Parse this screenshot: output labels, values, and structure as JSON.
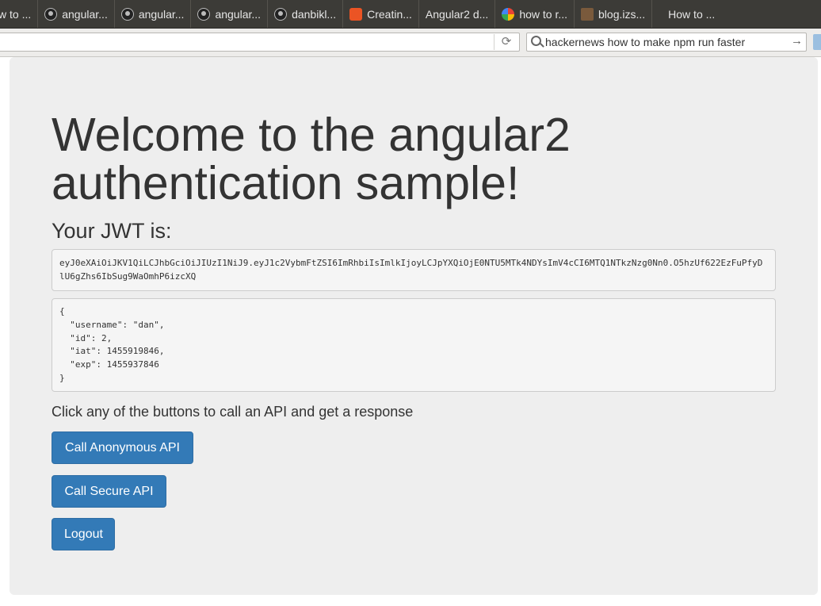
{
  "bookmarks": [
    {
      "label": "w to ...",
      "icon": "none"
    },
    {
      "label": "angular...",
      "icon": "github-icon"
    },
    {
      "label": "angular...",
      "icon": "github-icon"
    },
    {
      "label": "angular...",
      "icon": "github-icon"
    },
    {
      "label": "danbikl...",
      "icon": "github-icon"
    },
    {
      "label": "Creatin...",
      "icon": "auth0-icon"
    },
    {
      "label": "Angular2 d...",
      "icon": "none"
    },
    {
      "label": "how to r...",
      "icon": "google-icon"
    },
    {
      "label": "blog.izs...",
      "icon": "blog-icon"
    },
    {
      "label": "How to ...",
      "icon": "none"
    }
  ],
  "toolbar": {
    "url": "",
    "search_query": "hackernews how to make npm run faster"
  },
  "page": {
    "title": "Welcome to the angular2 authentication sample!",
    "jwt_heading": "Your JWT is:",
    "jwt": "eyJ0eXAiOiJKV1QiLCJhbGciOiJIUzI1NiJ9.eyJ1c2VybmFtZSI6ImRhbiIsImlkIjoyLCJpYXQiOjE0NTU5MTk4NDYsImV4cCI6MTQ1NTkzNzg0Nn0.O5hzUf622EzFuPfyDlU6gZhs6IbSug9WaOmhP6izcXQ",
    "decoded": "{\n  \"username\": \"dan\",\n  \"id\": 2,\n  \"iat\": 1455919846,\n  \"exp\": 1455937846\n}",
    "instruction": "Click any of the buttons to call an API and get a response",
    "buttons": {
      "anonymous": "Call Anonymous API",
      "secure": "Call Secure API",
      "logout": "Logout"
    }
  },
  "colors": {
    "primary_button": "#337ab7",
    "jumbotron_bg": "#eeeeee",
    "bookmarks_bar_bg": "#3c3b37"
  }
}
